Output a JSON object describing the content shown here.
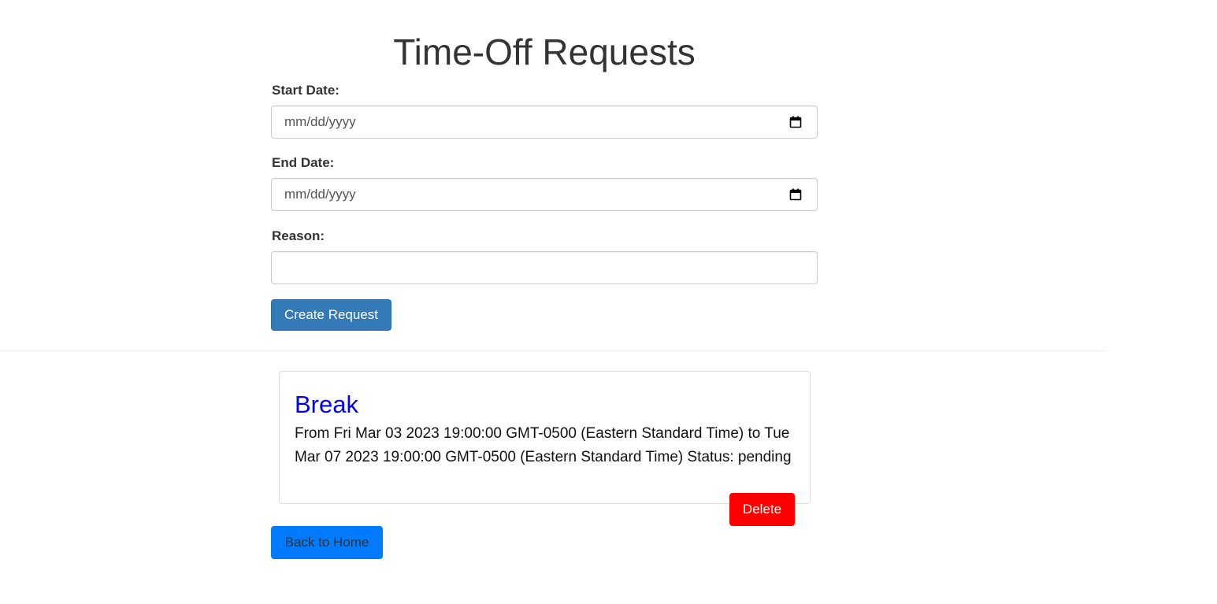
{
  "page": {
    "title": "Time-Off Requests"
  },
  "form": {
    "start_date": {
      "label": "Start Date:",
      "placeholder": "mm/dd/yyyy",
      "icon": "calendar-icon"
    },
    "end_date": {
      "label": "End Date:",
      "placeholder": "mm/dd/yyyy",
      "icon": "calendar-icon"
    },
    "reason": {
      "label": "Reason:",
      "value": ""
    },
    "submit_label": "Create Request"
  },
  "requests": [
    {
      "title": "Break",
      "details": "From Fri Mar 03 2023 19:00:00 GMT-0500 (Eastern Standard Time) to Tue Mar 07 2023 19:00:00 GMT-0500 (Eastern Standard Time) Status: pending",
      "delete_label": "Delete"
    }
  ],
  "footer": {
    "back_label": "Back to Home"
  },
  "colors": {
    "primary_button": "#337ab7",
    "delete_button": "#ff0000",
    "home_button": "#007bff",
    "request_title": "#0000ee"
  }
}
